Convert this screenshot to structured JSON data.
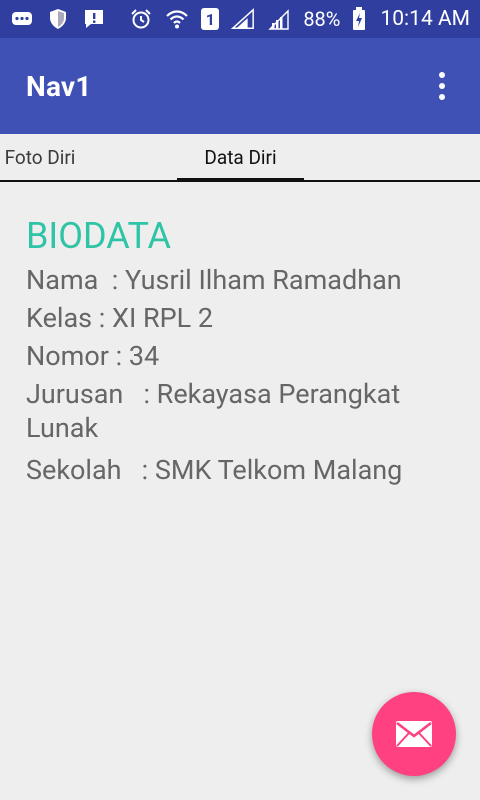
{
  "status_bar": {
    "battery_percent": "88%",
    "time": "10:14 AM",
    "sim_slot": "1",
    "icons": [
      "messaging-icon",
      "shield-icon",
      "alert-icon",
      "alarm-icon",
      "wifi-icon",
      "signal-icon",
      "signal-icon",
      "battery-charging-icon"
    ]
  },
  "app_bar": {
    "title": "Nav1",
    "overflow_icon": "more-vert-icon"
  },
  "tabs": [
    {
      "label": "Foto Diri",
      "active": false
    },
    {
      "label": "Data Diri",
      "active": true
    }
  ],
  "content": {
    "title": "BIODATA",
    "lines": [
      "Nama  : Yusril Ilham Ramadhan",
      "Kelas : XI RPL 2",
      "Nomor : 34",
      "Jurusan   : Rekayasa Perangkat Lunak",
      "Sekolah   : SMK Telkom Malang"
    ]
  },
  "fab": {
    "icon": "email-icon"
  },
  "colors": {
    "primary": "#3f51b5",
    "primary_dark": "#303f9f",
    "accent": "#ff4081",
    "title_accent": "#2ec4a5"
  }
}
